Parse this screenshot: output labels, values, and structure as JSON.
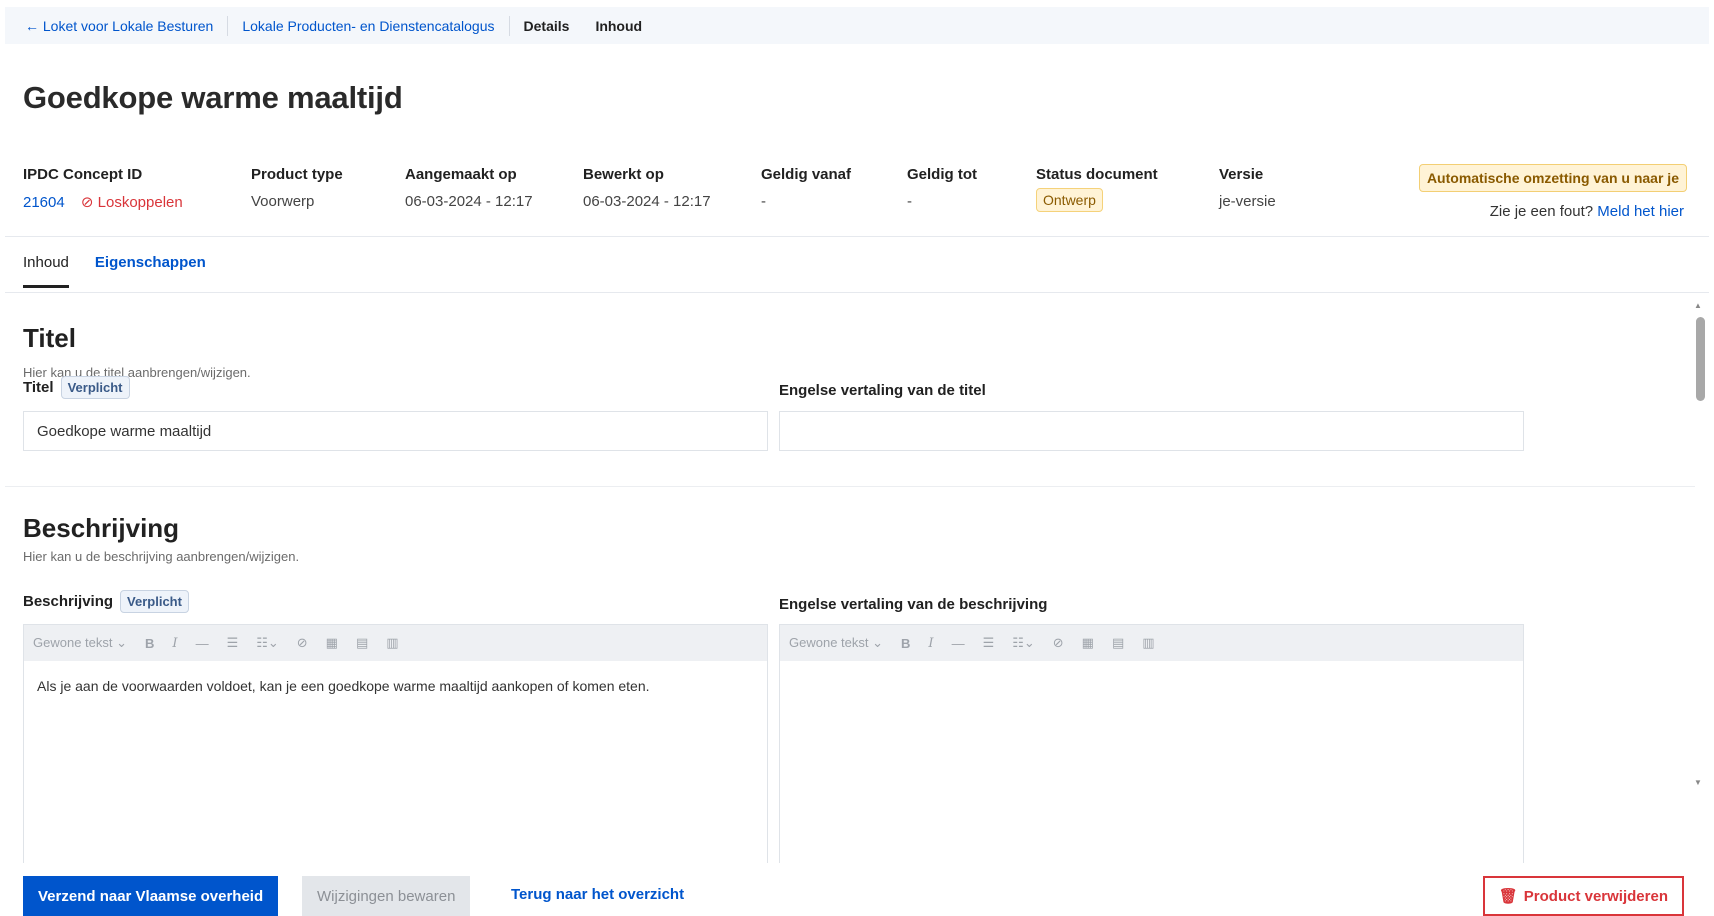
{
  "breadcrumb": {
    "back_arrow": "←",
    "items": [
      "Loket voor Lokale Besturen",
      "Lokale Producten- en Dienstencatalogus"
    ],
    "current": [
      "Details",
      "Inhoud"
    ]
  },
  "page": {
    "title": "Goedkope warme maaltijd"
  },
  "meta": {
    "concept_id": {
      "label": "IPDC Concept ID",
      "value": "21604",
      "unlink": "Loskoppelen"
    },
    "product_type": {
      "label": "Product type",
      "value": "Voorwerp"
    },
    "created": {
      "label": "Aangemaakt op",
      "value": "06-03-2024 - 12:17"
    },
    "edited": {
      "label": "Bewerkt op",
      "value": "06-03-2024 - 12:17"
    },
    "valid_from": {
      "label": "Geldig vanaf",
      "value": "-"
    },
    "valid_to": {
      "label": "Geldig tot",
      "value": "-"
    },
    "status": {
      "label": "Status document",
      "value": "Ontwerp"
    },
    "version": {
      "label": "Versie",
      "value": "je-versie"
    }
  },
  "notice": {
    "auto_convert": "Automatische omzetting van u naar je",
    "report_text": "Zie je een fout?",
    "report_link": "Meld het hier"
  },
  "tabs": [
    "Inhoud",
    "Eigenschappen"
  ],
  "sections": {
    "title": {
      "heading": "Titel",
      "subtitle": "Hier kan u de titel aanbrengen/wijzigen.",
      "field_label": "Titel",
      "required": "Verplicht",
      "field_value": "Goedkope warme maaltijd",
      "en_label": "Engelse vertaling van de titel",
      "en_value": ""
    },
    "description": {
      "heading": "Beschrijving",
      "subtitle": "Hier kan u de beschrijving aanbrengen/wijzigen.",
      "field_label": "Beschrijving",
      "required": "Verplicht",
      "field_value": "Als je aan de voorwaarden voldoet, kan je een goedkope warme maaltijd aankopen of komen eten.",
      "en_label": "Engelse vertaling van de beschrijving",
      "en_value": ""
    }
  },
  "toolbar": {
    "style_select": "Gewone tekst",
    "icons": [
      "bold-icon",
      "italic-icon",
      "horizontal-rule-icon",
      "bullet-list-icon",
      "numbered-list-icon",
      "link-icon",
      "table-icon",
      "table-row-icon",
      "table-column-icon"
    ]
  },
  "footer": {
    "send": "Verzend naar Vlaamse overheid",
    "save": "Wijzigingen bewaren",
    "back": "Terug naar het overzicht",
    "delete": "Product verwijderen"
  }
}
